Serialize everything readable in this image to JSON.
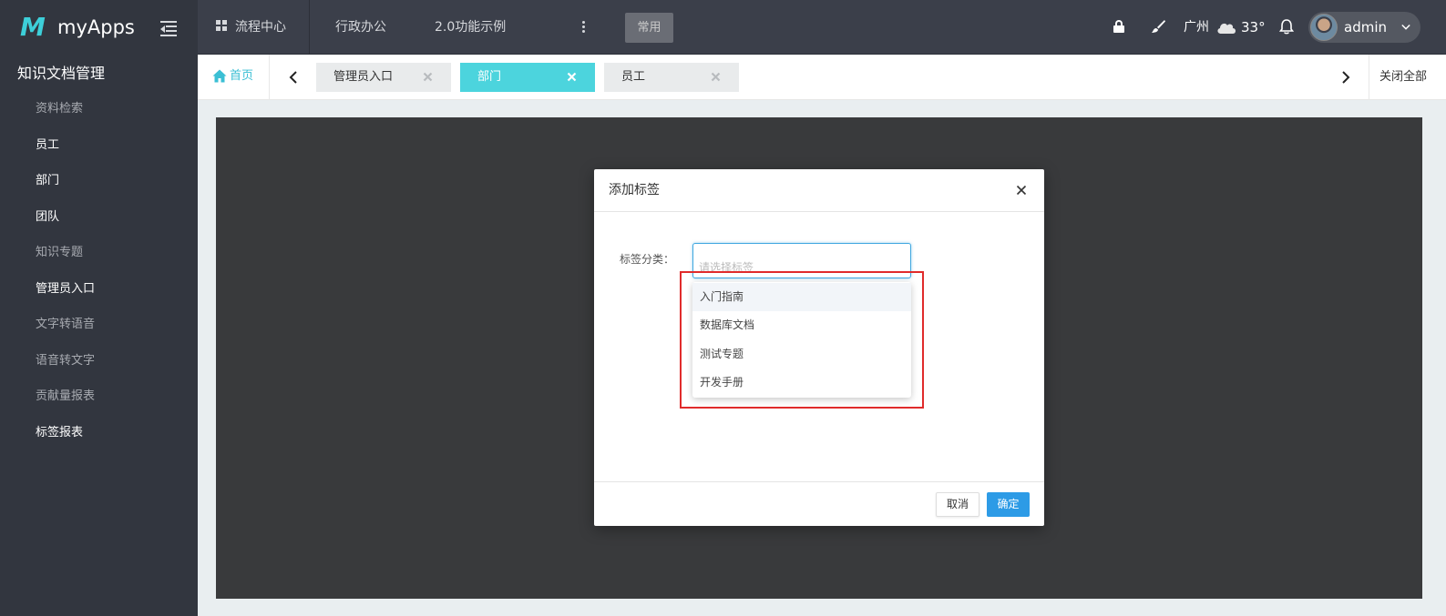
{
  "app": {
    "logo_letter": "M",
    "name": "myApps"
  },
  "topnav": {
    "items": [
      {
        "label": "流程中心",
        "icon": "grid-icon"
      },
      {
        "label": "行政办公"
      },
      {
        "label": "2.0功能示例"
      }
    ],
    "common_button": "常用",
    "city": "广州",
    "temperature": "33°",
    "user": "admin",
    "accent_color": "#4cd4dd"
  },
  "sidebar": {
    "title": "知识文档管理",
    "items": [
      {
        "label": "资料检索",
        "active": false
      },
      {
        "label": "员工",
        "active": true
      },
      {
        "label": "部门",
        "active": true
      },
      {
        "label": "团队",
        "active": true
      },
      {
        "label": "知识专题",
        "active": false
      },
      {
        "label": "管理员入口",
        "active": true
      },
      {
        "label": "文字转语音",
        "active": false
      },
      {
        "label": "语音转文字",
        "active": false
      },
      {
        "label": "贡献量报表",
        "active": false
      },
      {
        "label": "标签报表",
        "active": true
      }
    ]
  },
  "tabs": {
    "home_label": "首页",
    "items": [
      {
        "label": "管理员入口",
        "active": false
      },
      {
        "label": "部门",
        "active": true
      },
      {
        "label": "员工",
        "active": false
      }
    ],
    "close_all": "关闭全部"
  },
  "modal": {
    "title": "添加标签",
    "field_label": "标签分类：",
    "select_placeholder": "请选择标签",
    "options": [
      "入门指南",
      "数据库文档",
      "测试专题",
      "开发手册"
    ],
    "hovered_option": "入门指南",
    "cancel_label": "取消",
    "ok_label": "确定",
    "highlight_color": "#e02b2b",
    "primary_color": "#2d9be6"
  }
}
